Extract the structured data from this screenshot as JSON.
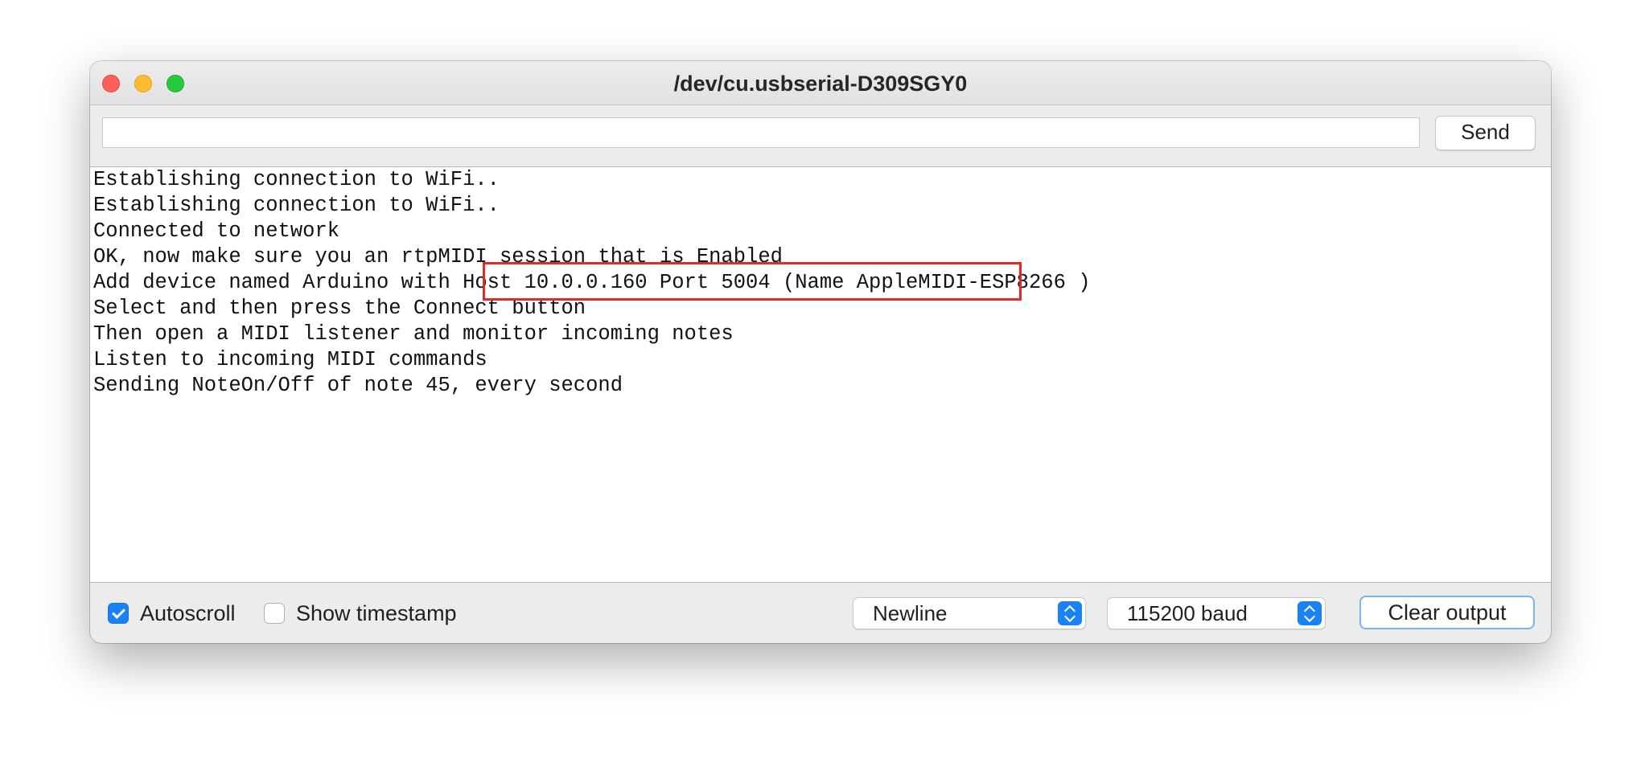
{
  "window": {
    "title": "/dev/cu.usbserial-D309SGY0"
  },
  "input": {
    "value": "",
    "send_label": "Send"
  },
  "output": {
    "lines": [
      "Establishing connection to WiFi..",
      "Establishing connection to WiFi..",
      "Connected to network",
      "OK, now make sure you an rtpMIDI session that is Enabled",
      "Add device named Arduino with Host 10.0.0.160 Port 5004 (Name AppleMIDI-ESP8266 )",
      "Select and then press the Connect button",
      "Then open a MIDI listener and monitor incoming notes",
      "Listen to incoming MIDI commands",
      "Sending NoteOn/Off of note 45, every second"
    ],
    "highlight_color": "#e02b27"
  },
  "footer": {
    "autoscroll": {
      "label": "Autoscroll",
      "checked": true
    },
    "timestamp": {
      "label": "Show timestamp",
      "checked": false
    },
    "line_ending": "Newline",
    "baud": "115200 baud",
    "clear_label": "Clear output"
  },
  "colors": {
    "accent": "#1a82f7",
    "close": "#ff5f57",
    "minimize": "#febc2e",
    "maximize": "#28c840"
  }
}
